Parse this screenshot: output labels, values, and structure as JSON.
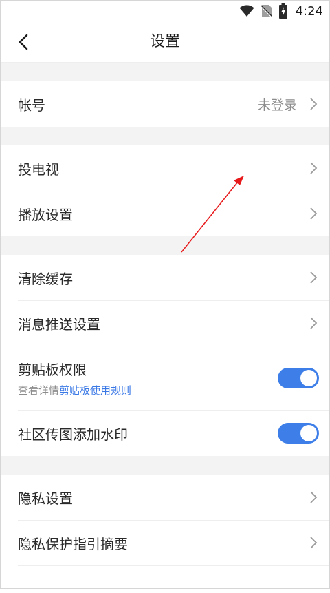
{
  "status_bar": {
    "time": "4:24"
  },
  "header": {
    "title": "设置"
  },
  "rows": {
    "account": {
      "label": "帐号",
      "value": "未登录"
    },
    "cast": {
      "label": "投电视"
    },
    "playback": {
      "label": "播放设置"
    },
    "clear_cache": {
      "label": "清除缓存"
    },
    "push": {
      "label": "消息推送设置"
    },
    "clipboard": {
      "label": "剪贴板权限",
      "sub_prefix": "查看详情",
      "sub_link": "剪贴板使用规则",
      "enabled": true
    },
    "watermark": {
      "label": "社区传图添加水印",
      "enabled": true
    },
    "privacy": {
      "label": "隐私设置"
    },
    "privacy_guide": {
      "label": "隐私保护指引摘要"
    }
  },
  "colors": {
    "accent": "#3d7ee8",
    "link": "#3a78e6",
    "annotation_arrow": "#e8191b"
  }
}
